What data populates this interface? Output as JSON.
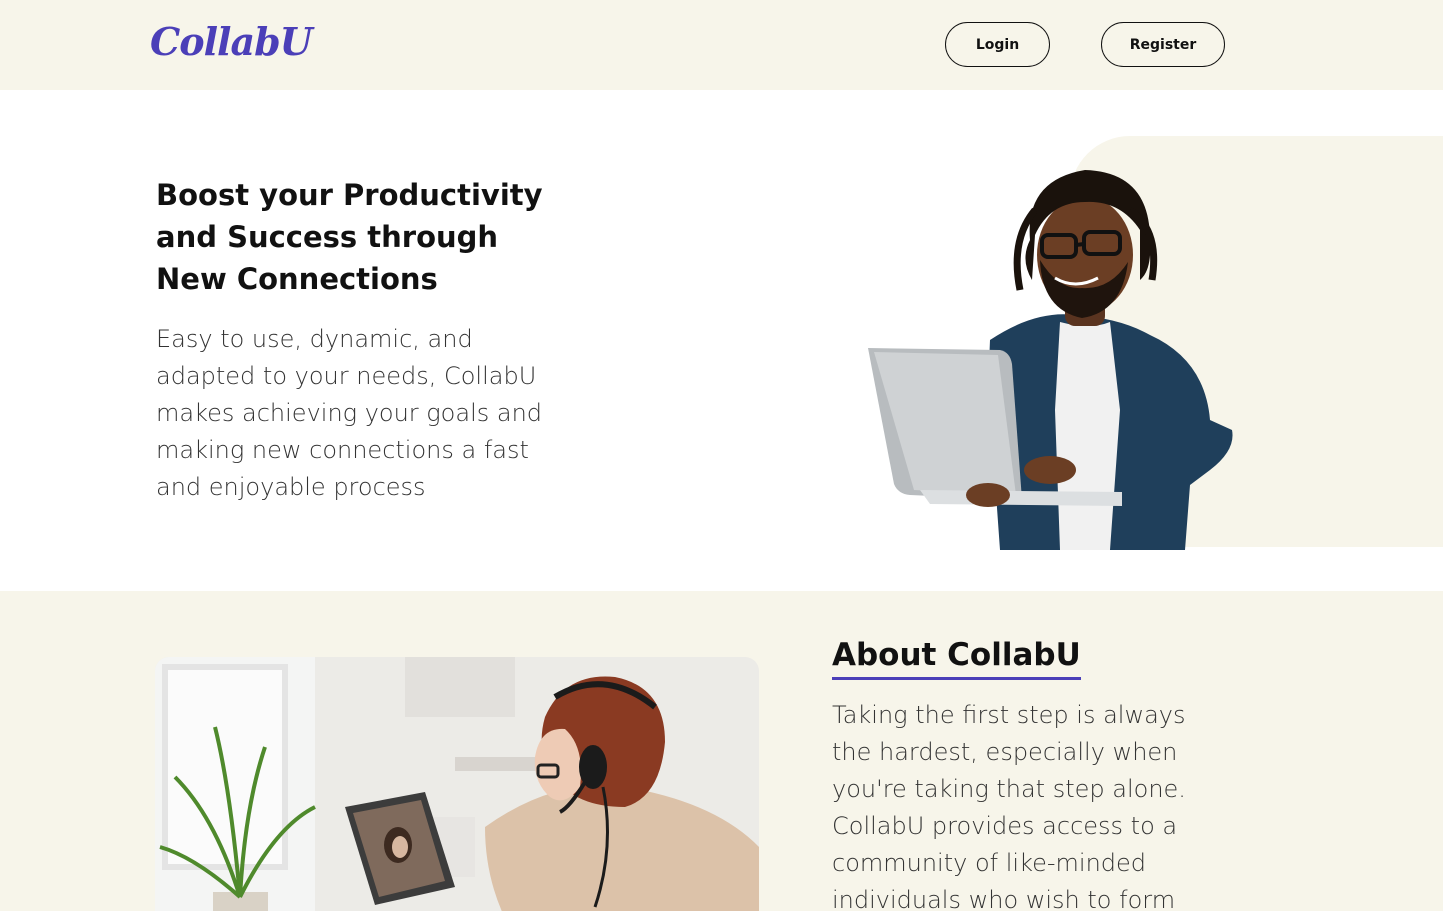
{
  "header": {
    "logo_text": "CollabU",
    "login_label": "Login",
    "register_label": "Register"
  },
  "hero": {
    "title": "Boost your Productivity and Success through New Connections",
    "description": "Easy to use, dynamic, and adapted to your needs, CollabU makes achieving your goals and making new connections a fast and enjoyable process"
  },
  "about": {
    "title": "About CollabU",
    "description": "Taking the first step is always the hardest, especially when you're taking that step alone. CollabU provides access to a community of like-minded individuals who wish to form healthy habits and"
  },
  "colors": {
    "brand": "#4b3fb8",
    "cream": "#f7f5ea",
    "text": "#111111"
  }
}
